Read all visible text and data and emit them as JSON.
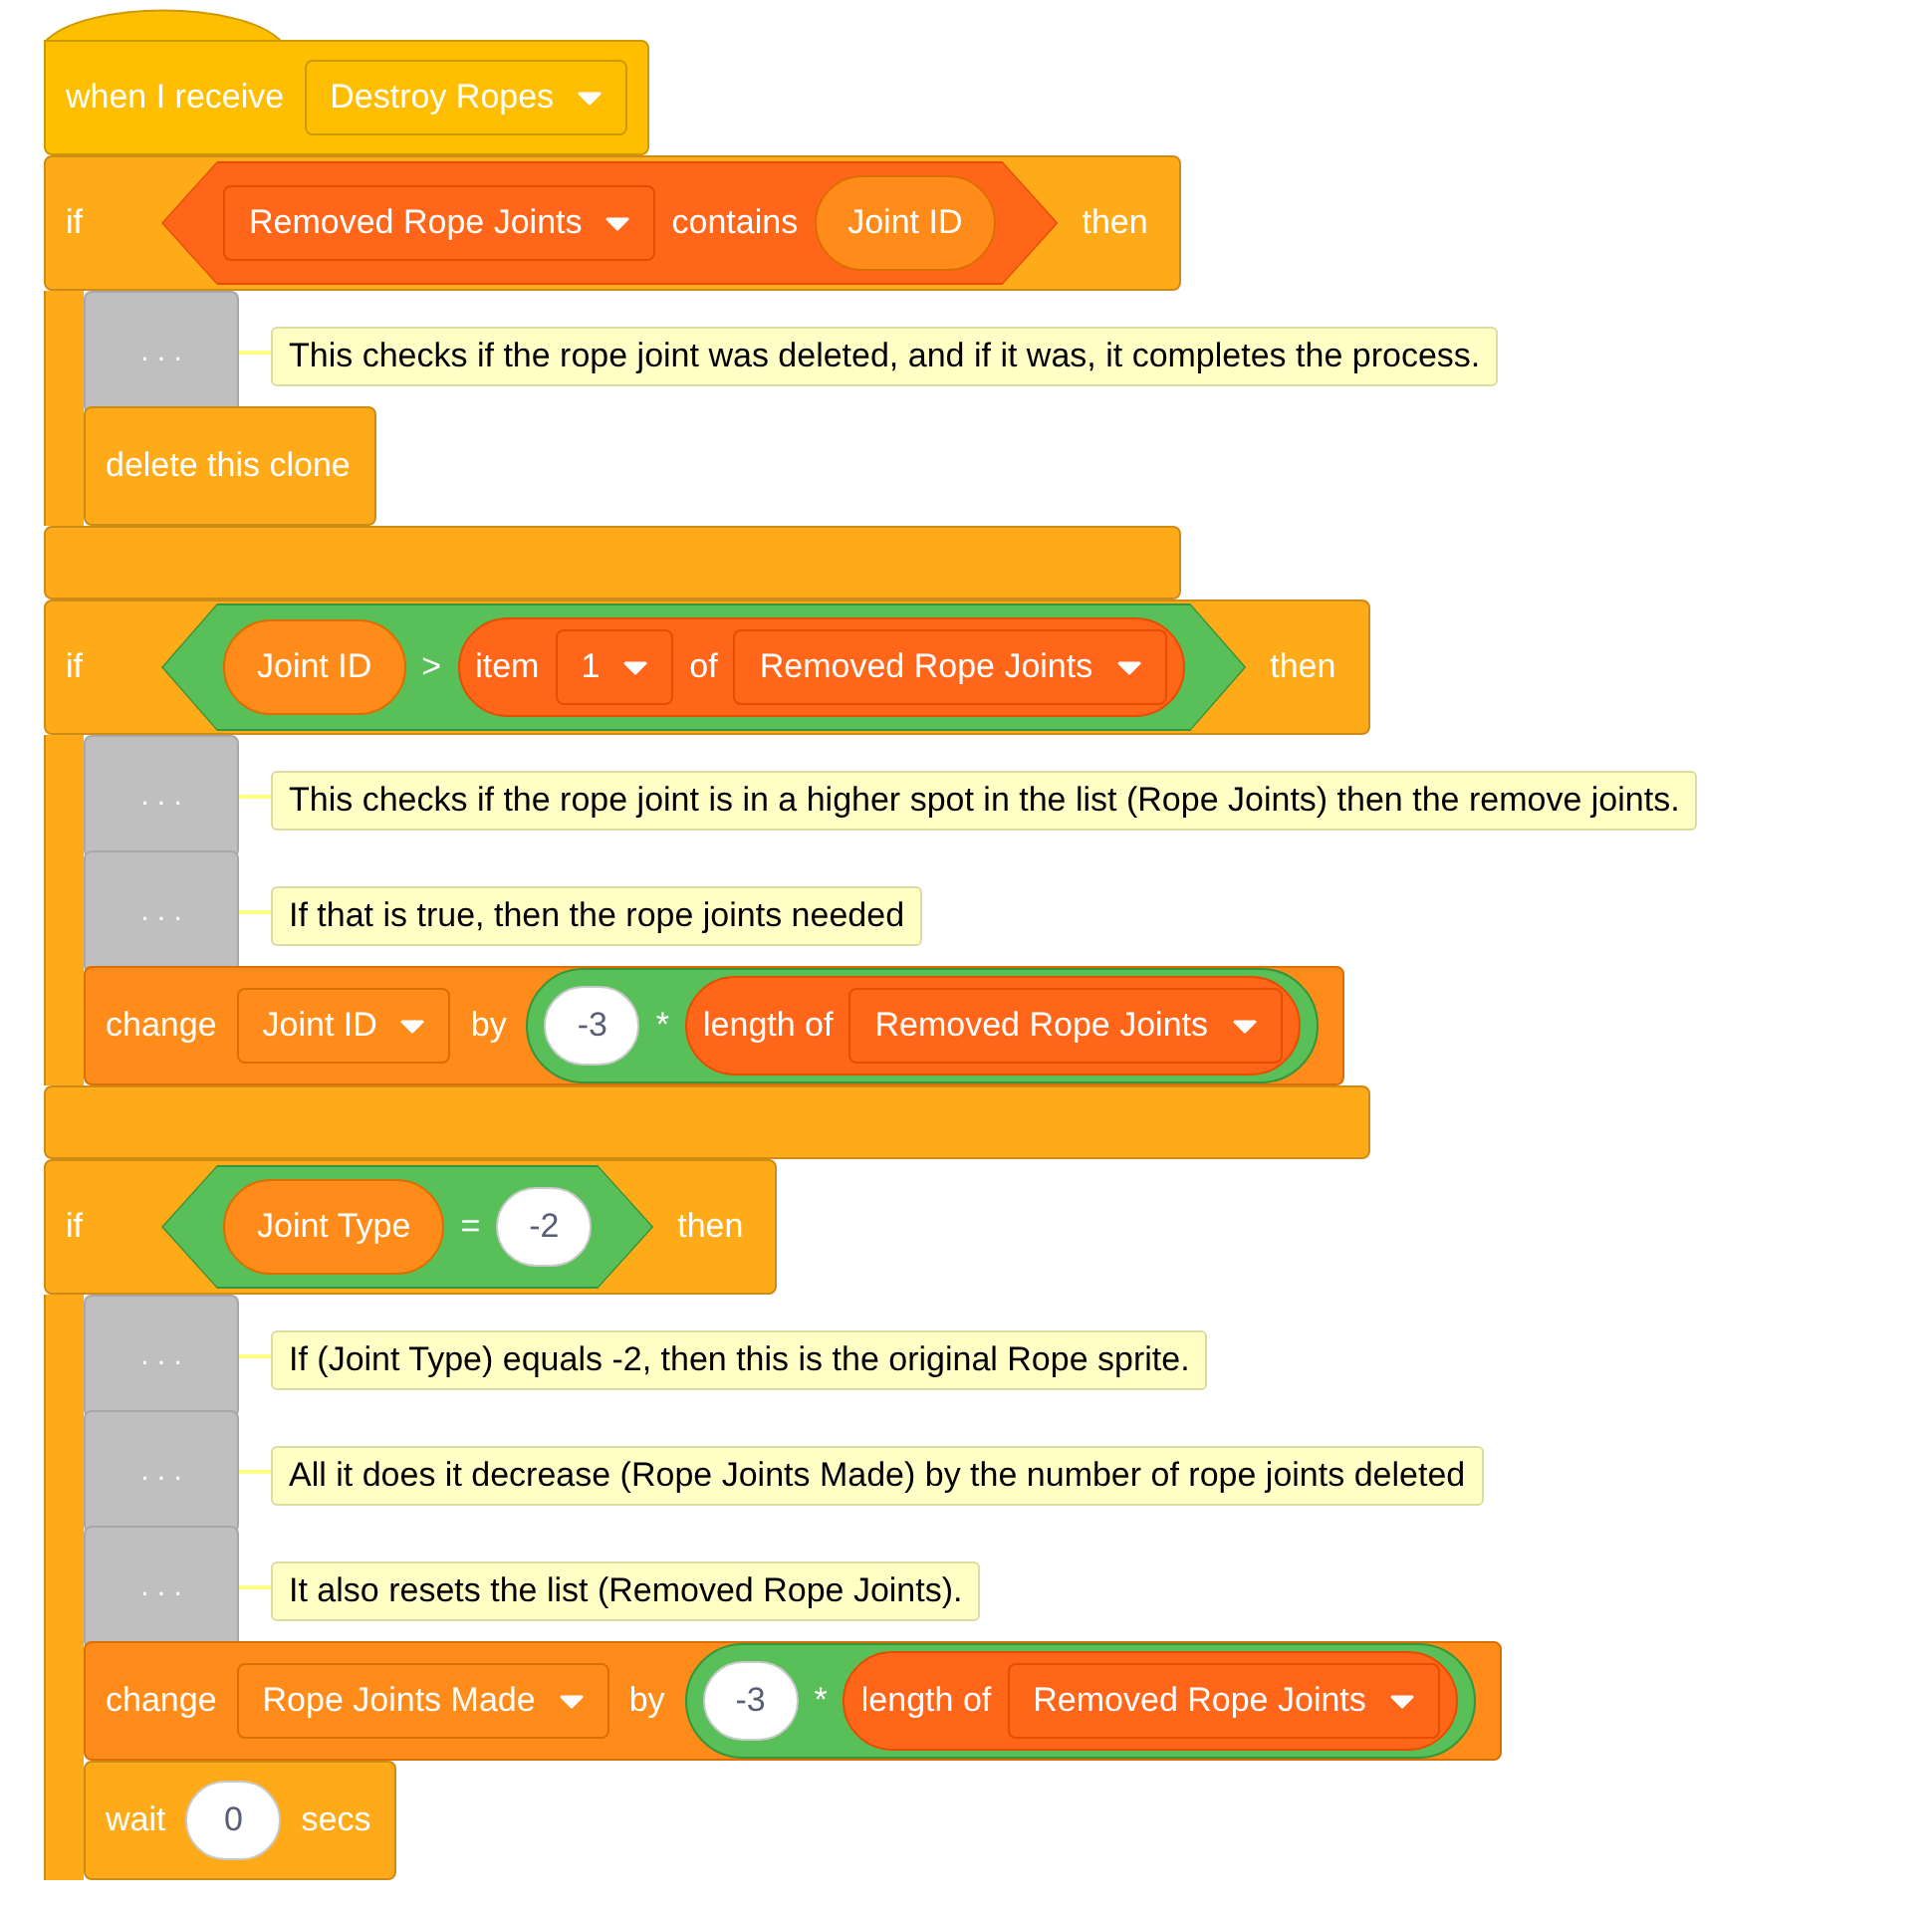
{
  "script": {
    "hat": {
      "color": "#ffbf00",
      "parts": [
        {
          "kind": "text",
          "text": "when I receive"
        },
        {
          "kind": "menu",
          "text": "Destroy Ropes"
        }
      ]
    },
    "blocks": [
      {
        "kind": "if",
        "label": "if",
        "then": "then",
        "end_visible": true,
        "condition": {
          "kind": "hex",
          "color": "#ff661a",
          "parts": [
            {
              "kind": "menu",
              "text": "Removed Rope Joints"
            },
            {
              "kind": "text",
              "text": "contains"
            },
            {
              "kind": "variable",
              "text": "Joint ID"
            }
          ]
        },
        "body": [
          {
            "kind": "comment",
            "stub": ". . .",
            "note": "This checks if the rope joint was deleted, and if it was, it completes the process."
          },
          {
            "kind": "stack",
            "color": "#ffab19",
            "parts": [
              {
                "kind": "text",
                "text": "delete this clone"
              }
            ]
          }
        ]
      },
      {
        "kind": "if",
        "label": "if",
        "then": "then",
        "end_visible": true,
        "condition": {
          "kind": "hex",
          "color": "#59c059",
          "parts": [
            {
              "kind": "variable",
              "text": "Joint ID"
            },
            {
              "kind": "text",
              "text": ">"
            },
            {
              "kind": "round",
              "color": "#ff661a",
              "parts": [
                {
                  "kind": "text",
                  "text": "item"
                },
                {
                  "kind": "menu",
                  "text": "1"
                },
                {
                  "kind": "text",
                  "text": "of"
                },
                {
                  "kind": "menu",
                  "text": "Removed Rope Joints"
                }
              ]
            }
          ]
        },
        "body": [
          {
            "kind": "comment",
            "stub": ". . .",
            "note": "This checks if the rope joint is in a higher spot in the list (Rope Joints) then the remove joints."
          },
          {
            "kind": "comment",
            "stub": ". . .",
            "note": "If that is true, then the rope joints needed"
          },
          {
            "kind": "stack",
            "color": "#ff8c1a",
            "parts": [
              {
                "kind": "text",
                "text": "change"
              },
              {
                "kind": "menu",
                "text": "Joint ID"
              },
              {
                "kind": "text",
                "text": "by"
              },
              {
                "kind": "round",
                "color": "#59c059",
                "parts": [
                  {
                    "kind": "number",
                    "text": "-3"
                  },
                  {
                    "kind": "text",
                    "text": "*"
                  },
                  {
                    "kind": "round",
                    "color": "#ff661a",
                    "parts": [
                      {
                        "kind": "text",
                        "text": "length of"
                      },
                      {
                        "kind": "menu",
                        "text": "Removed Rope Joints"
                      }
                    ]
                  }
                ]
              }
            ]
          }
        ]
      },
      {
        "kind": "if",
        "label": "if",
        "then": "then",
        "end_visible": false,
        "condition": {
          "kind": "hex",
          "color": "#59c059",
          "parts": [
            {
              "kind": "variable",
              "text": "Joint Type"
            },
            {
              "kind": "text",
              "text": "="
            },
            {
              "kind": "number",
              "text": "-2"
            }
          ]
        },
        "body": [
          {
            "kind": "comment",
            "stub": ". . .",
            "note": "If (Joint Type) equals -2, then this is the original Rope sprite."
          },
          {
            "kind": "comment",
            "stub": ". . .",
            "note": "All it does it decrease (Rope Joints Made) by the number of rope joints deleted"
          },
          {
            "kind": "comment",
            "stub": ". . .",
            "note": "It also resets the list (Removed Rope Joints)."
          },
          {
            "kind": "stack",
            "color": "#ff8c1a",
            "parts": [
              {
                "kind": "text",
                "text": "change"
              },
              {
                "kind": "menu",
                "text": "Rope Joints Made"
              },
              {
                "kind": "text",
                "text": "by"
              },
              {
                "kind": "round",
                "color": "#59c059",
                "parts": [
                  {
                    "kind": "number",
                    "text": "-3"
                  },
                  {
                    "kind": "text",
                    "text": "*"
                  },
                  {
                    "kind": "round",
                    "color": "#ff661a",
                    "parts": [
                      {
                        "kind": "text",
                        "text": "length of"
                      },
                      {
                        "kind": "menu",
                        "text": "Removed Rope Joints"
                      }
                    ]
                  }
                ]
              }
            ]
          },
          {
            "kind": "stack",
            "color": "#ffab19",
            "parts": [
              {
                "kind": "text",
                "text": "wait"
              },
              {
                "kind": "number",
                "text": "0"
              },
              {
                "kind": "text",
                "text": "secs"
              }
            ]
          }
        ]
      }
    ]
  }
}
